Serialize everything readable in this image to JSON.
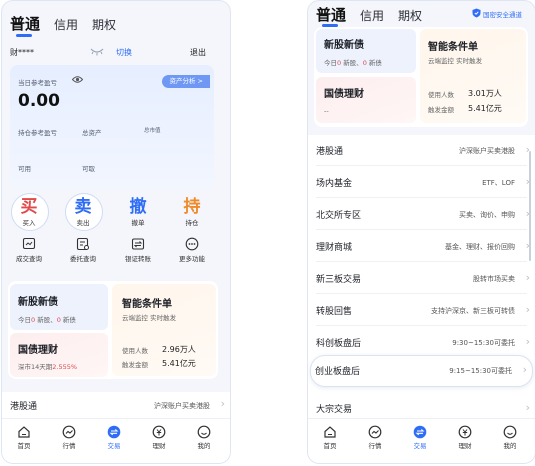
{
  "tabs": [
    "普通",
    "信用",
    "期权"
  ],
  "left": {
    "account": "财****",
    "switch": "切换",
    "logout": "退出",
    "asset": {
      "pnl_label": "当日参考盈亏",
      "pnl_value": "0.00",
      "analysis_btn": "资产分析 >",
      "row1": [
        "持仓参考盈亏",
        "总资产",
        "总市值"
      ],
      "row2": [
        "可用",
        "可取"
      ]
    },
    "actions": [
      {
        "glyph": "买",
        "label": "买入",
        "color": "#e04a4a"
      },
      {
        "glyph": "卖",
        "label": "卖出",
        "color": "#2f6df6"
      },
      {
        "glyph": "撤",
        "label": "撤单",
        "color": "#2f6df6"
      },
      {
        "glyph": "持",
        "label": "持仓",
        "color": "#ef8b2a"
      }
    ],
    "functions": [
      {
        "label": "成交查询",
        "icon": "trade-query-icon"
      },
      {
        "label": "委托查询",
        "icon": "order-query-icon"
      },
      {
        "label": "银证转账",
        "icon": "bank-transfer-icon"
      },
      {
        "label": "更多功能",
        "icon": "more-icon"
      }
    ],
    "cards": {
      "ipo": {
        "title": "新股新债",
        "sub_prefix": "今日",
        "sub_num1": "0",
        "sub_mid": " 新股、",
        "sub_num2": "0",
        "sub_suffix": " 新债"
      },
      "cond": {
        "title": "智能条件单",
        "sub": "云端监控 实时触发"
      },
      "bond": {
        "title": "国债理财",
        "sub_prefix": "深市14天期",
        "sub_rate": "2.555%"
      },
      "stats": {
        "users_label": "使用人数",
        "users_value": "2.96万人",
        "amount_label": "触发金额",
        "amount_value": "5.41亿元"
      }
    },
    "hk_row": {
      "label": "港股通",
      "right": "沪深账户买卖港股"
    }
  },
  "right": {
    "safety": "国密安全通道",
    "cards": {
      "ipo": {
        "title": "新股新债",
        "sub_prefix": "今日",
        "sub_num1": "0",
        "sub_mid": " 新股、",
        "sub_num2": "0",
        "sub_suffix": " 新债"
      },
      "cond": {
        "title": "智能条件单",
        "sub": "云端监控 实时触发"
      },
      "bond": {
        "title": "国债理财",
        "sub": "--"
      },
      "stats": {
        "users_label": "使用人数",
        "users_value": "3.01万人",
        "amount_label": "触发金额",
        "amount_value": "5.41亿元"
      }
    },
    "rows": [
      {
        "label": "港股通",
        "right": "沪深账户买卖港股"
      },
      {
        "label": "场内基金",
        "right": "ETF、LOF"
      },
      {
        "label": "北交所专区",
        "right": "买卖、询价、申购"
      },
      {
        "label": "理财商城",
        "right": "基金、理财、报价回购"
      },
      {
        "label": "新三板交易",
        "right": "股转市场买卖"
      },
      {
        "label": "转股回售",
        "right": "支持沪深京、新三板可转债"
      },
      {
        "label": "科创板盘后",
        "right": "9:30~15:30可委托"
      },
      {
        "label": "创业板盘后",
        "right": "9:15~15:30可委托"
      },
      {
        "label": "大宗交易",
        "right": ""
      }
    ]
  },
  "nav": [
    "首页",
    "行情",
    "交易",
    "理财",
    "我的"
  ],
  "colors": {
    "accent": "#2f6df6",
    "red": "#e04a4a",
    "orange": "#ef8b2a"
  }
}
